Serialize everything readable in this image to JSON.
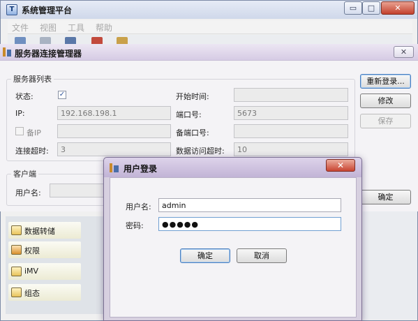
{
  "main_window": {
    "title": "系统管理平台",
    "icon_glyph": "T",
    "minimize_glyph": "▭",
    "maximize_glyph": "□",
    "close_glyph": "✕",
    "menu": [
      "文件",
      "视图",
      "工具",
      "帮助"
    ]
  },
  "server_manager": {
    "title": "服务器连接管理器",
    "close_glyph": "✕",
    "server_group": {
      "label": "服务器列表",
      "status_label": "状态:",
      "status_checked": true,
      "check_glyph": "✓",
      "ip_label": "IP:",
      "ip_value": "192.168.198.1",
      "backup_ip_label": "备IP",
      "backup_ip_checked": false,
      "backup_ip_value": "",
      "connect_timeout_label": "连接超时:",
      "connect_timeout_value": "3",
      "start_time_label": "开始时间:",
      "start_time_value": "",
      "port_label": "端口号:",
      "port_value": "5673",
      "backup_port_label": "备端口号:",
      "backup_port_value": "",
      "data_timeout_label": "数据访问超时:",
      "data_timeout_value": "10"
    },
    "client_group": {
      "label": "客户端",
      "username_label": "用户名:",
      "username_value": ""
    },
    "buttons": {
      "relogin": "重新登录...",
      "modify": "修改",
      "save": "保存",
      "ok": "确定"
    }
  },
  "nav": {
    "items": [
      {
        "label": "数据转储",
        "icon": "data-dump-icon"
      },
      {
        "label": "权限",
        "icon": "users-icon"
      },
      {
        "label": "iMV",
        "icon": "imv-icon"
      },
      {
        "label": "组态",
        "icon": "config-icon"
      }
    ]
  },
  "login_dialog": {
    "title": "用户登录",
    "close_glyph": "✕",
    "username_label": "用户名:",
    "username_value": "admin",
    "password_label": "密码:",
    "password_masked": "●●●●●",
    "ok_label": "确定",
    "cancel_label": "取消"
  },
  "colors": {
    "title_main": "#cfd8ea",
    "title_dialog": "#c2b4d6",
    "close_red": "#c84431"
  }
}
